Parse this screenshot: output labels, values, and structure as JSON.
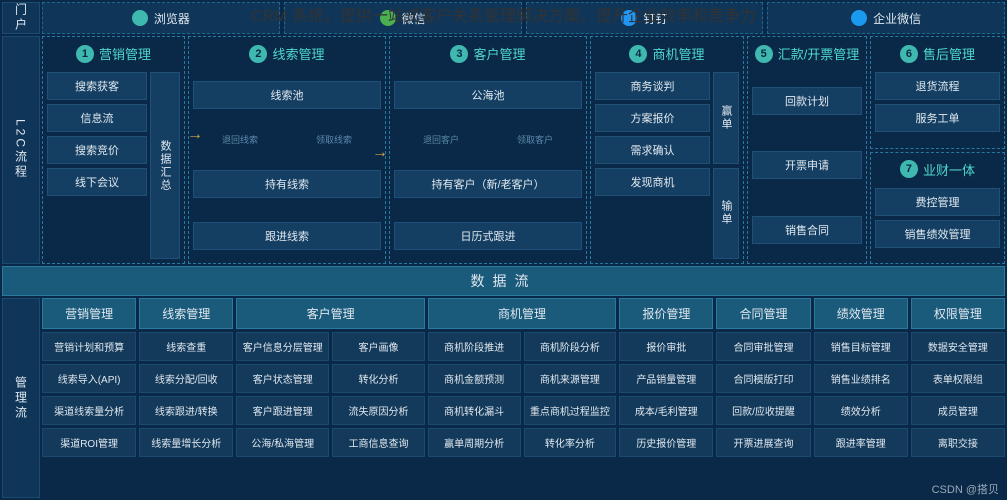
{
  "header": "CRM 系统，提供一站式客户关系管理解决方案，提升企业效率和竞争力",
  "side": {
    "portal": "门户",
    "l2c": "L2C流程",
    "mgmt": "管理流"
  },
  "portals": [
    {
      "icon": "browser-icon",
      "label": "浏览器"
    },
    {
      "icon": "wechat-icon",
      "label": "微信"
    },
    {
      "icon": "dingtalk-icon",
      "label": "钉钉"
    },
    {
      "icon": "enterprise-wechat-icon",
      "label": "企业微信"
    }
  ],
  "l2c": {
    "col1": {
      "num": "1",
      "title": "营销管理",
      "items": [
        "搜索获客",
        "信息流",
        "搜索竞价",
        "线下会议"
      ],
      "side": "数据汇总"
    },
    "col2": {
      "num": "2",
      "title": "线索管理",
      "items": [
        "线索池",
        "持有线索",
        "跟进线索"
      ],
      "hints": [
        "退回线索",
        "领取线索"
      ]
    },
    "col3": {
      "num": "3",
      "title": "客户管理",
      "items": [
        "公海池",
        "持有客户（新/老客户）",
        "日历式跟进"
      ],
      "hints": [
        "退回客户",
        "领取客户"
      ]
    },
    "col4": {
      "num": "4",
      "title": "商机管理",
      "items": [
        "商务谈判",
        "方案报价",
        "需求确认",
        "发现商机"
      ],
      "side": [
        "赢单",
        "输单"
      ]
    },
    "col5": {
      "num": "5",
      "title": "汇款/开票管理",
      "items": [
        "回款计划",
        "开票申请",
        "销售合同"
      ]
    },
    "col6": {
      "num": "6",
      "title": "售后管理",
      "items": [
        "退货流程",
        "服务工单"
      ]
    },
    "col7": {
      "num": "7",
      "title": "业财一体",
      "items": [
        "费控管理",
        "销售绩效管理"
      ]
    }
  },
  "dataflow": "数据流",
  "mgmt": {
    "cols": [
      {
        "header": "营销管理",
        "items": [
          "营销计划和预算",
          "线索导入(API)",
          "渠道线索量分析",
          "渠道ROI管理"
        ]
      },
      {
        "header": "线索管理",
        "items": [
          "线索查重",
          "线索分配/回收",
          "线索跟进/转换",
          "线索量增长分析"
        ]
      },
      {
        "header": "客户管理",
        "wide": true,
        "items": [
          "客户信息分层管理",
          "客户画像",
          "客户状态管理",
          "转化分析",
          "客户跟进管理",
          "流失原因分析",
          "公海/私海管理",
          "工商信息查询"
        ]
      },
      {
        "header": "商机管理",
        "wide": true,
        "items": [
          "商机阶段推进",
          "商机阶段分析",
          "商机金额预测",
          "商机来源管理",
          "商机转化漏斗",
          "重点商机过程监控",
          "赢单周期分析",
          "转化率分析"
        ]
      },
      {
        "header": "报价管理",
        "items": [
          "报价审批",
          "产品销量管理",
          "成本/毛利管理",
          "历史报价管理"
        ]
      },
      {
        "header": "合同管理",
        "items": [
          "合同审批管理",
          "合同模版打印",
          "回款/应收提醒",
          "开票进展查询"
        ]
      },
      {
        "header": "绩效管理",
        "items": [
          "销售目标管理",
          "销售业绩排名",
          "绩效分析",
          "跟进率管理"
        ]
      },
      {
        "header": "权限管理",
        "items": [
          "数据安全管理",
          "表单权限组",
          "成员管理",
          "离职交接"
        ]
      }
    ]
  },
  "footer": "CSDN @搭贝"
}
